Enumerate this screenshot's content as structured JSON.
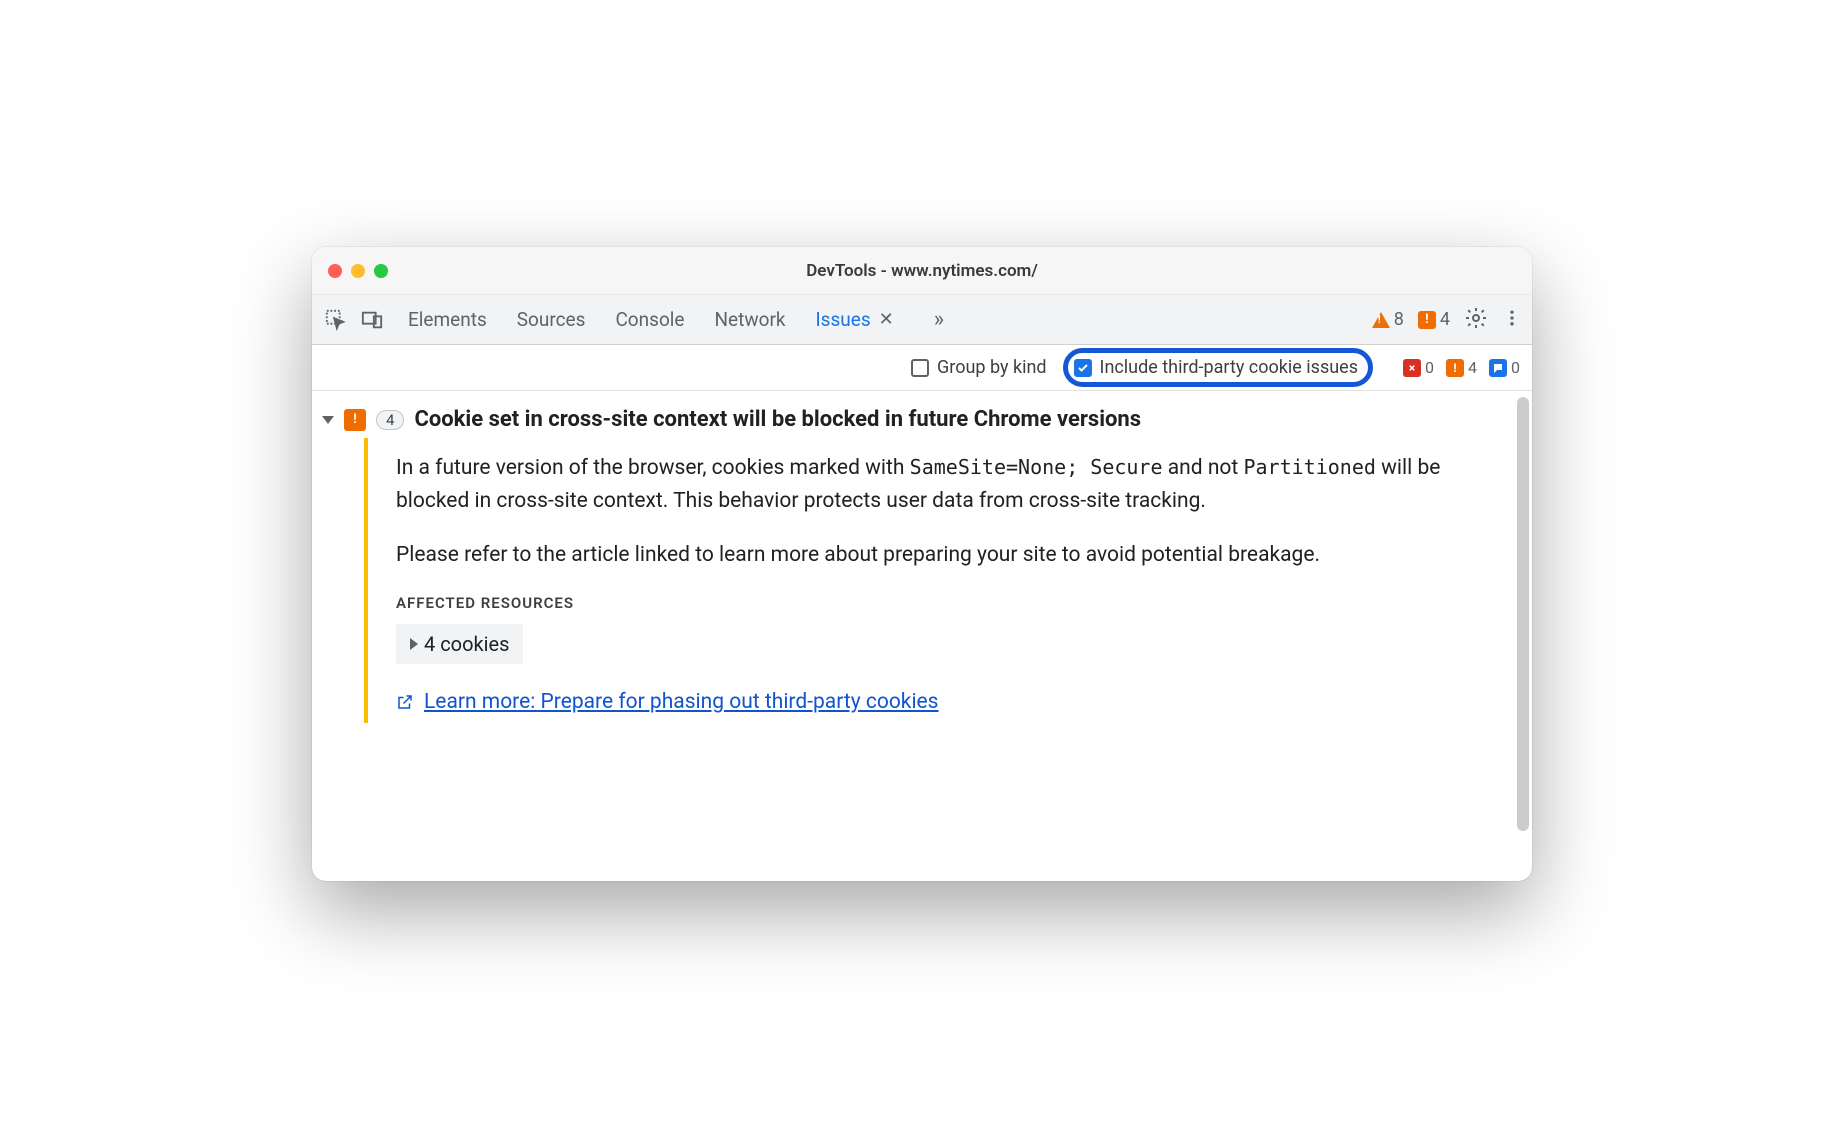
{
  "window": {
    "title": "DevTools - www.nytimes.com/"
  },
  "toolbar": {
    "tabs": {
      "elements": "Elements",
      "sources": "Sources",
      "console": "Console",
      "network": "Network",
      "issues": "Issues"
    },
    "warning_count": "8",
    "breaking_count": "4"
  },
  "filter": {
    "group_by_kind": "Group by kind",
    "include_3p": "Include third-party cookie issues",
    "mini": {
      "errors": "0",
      "warnings": "4",
      "info": "0"
    }
  },
  "issue": {
    "count": "4",
    "title": "Cookie set in cross-site context will be blocked in future Chrome versions",
    "para1_pre": "In a future version of the browser, cookies marked with ",
    "para1_code1": "SameSite=None; Secure",
    "para1_mid": " and not ",
    "para1_code2": "Partitioned",
    "para1_post": " will be blocked in cross-site context. This behavior protects user data from cross-site tracking.",
    "para2": "Please refer to the article linked to learn more about preparing your site to avoid potential breakage.",
    "affected_label": "AFFECTED RESOURCES",
    "cookies_label": "4 cookies",
    "learn_more": "Learn more: Prepare for phasing out third-party cookies"
  }
}
